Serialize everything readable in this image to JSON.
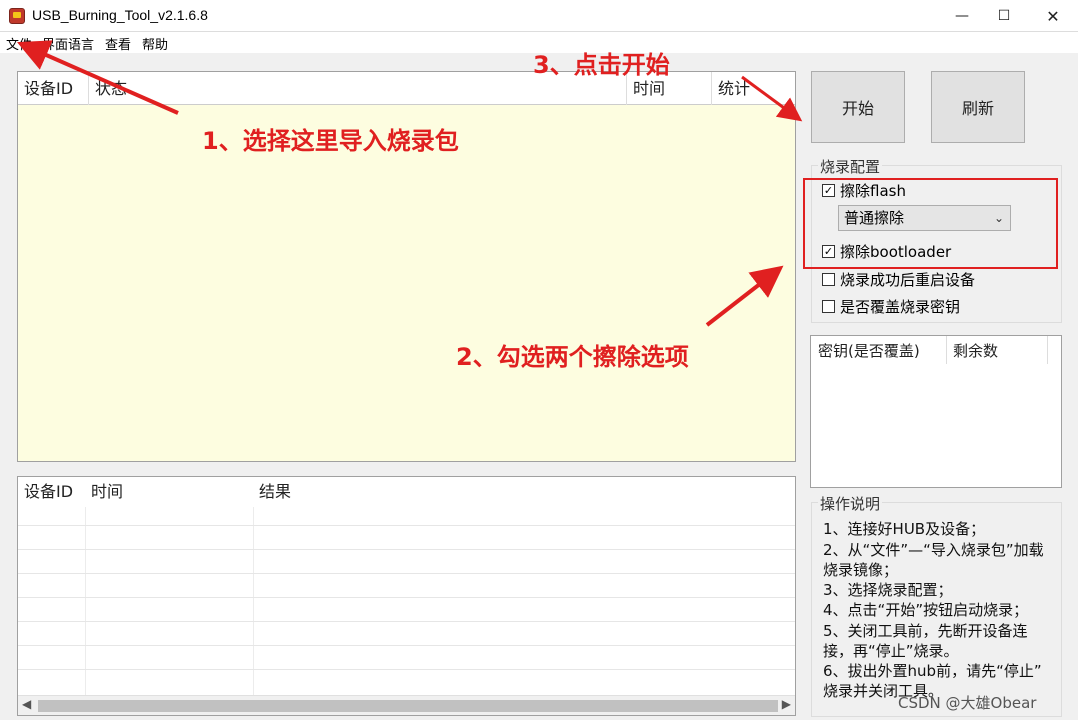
{
  "window": {
    "title": "USB_Burning_Tool_v2.1.6.8"
  },
  "menu": [
    "文件",
    "界面语言",
    "查看",
    "帮助"
  ],
  "status_list": {
    "columns": [
      "设备ID",
      "状态",
      "时间",
      "统计"
    ]
  },
  "result_list": {
    "columns": [
      "设备ID",
      "时间",
      "结果"
    ]
  },
  "buttons": {
    "start": "开始",
    "refresh": "刷新"
  },
  "burn_config": {
    "title": "烧录配置",
    "erase_flash": {
      "label": "擦除flash",
      "checked": true
    },
    "erase_mode": "普通擦除",
    "erase_bootloader": {
      "label": "擦除bootloader",
      "checked": true
    },
    "reboot_after": {
      "label": "烧录成功后重启设备",
      "checked": false
    },
    "overwrite_key": {
      "label": "是否覆盖烧录密钥",
      "checked": false
    }
  },
  "key_list": {
    "columns": [
      "密钥(是否覆盖)",
      "剩余数"
    ]
  },
  "instructions": {
    "title": "操作说明",
    "lines": [
      "1、连接好HUB及设备；",
      "2、从“文件”—“导入烧录包”加载",
      "烧录镜像；",
      "3、选择烧录配置；",
      "4、点击“开始”按钮启动烧录；",
      "5、关闭工具前，先断开设备连",
      "接，再“停止”烧录。",
      "6、拔出外置hub前，请先“停止”",
      "烧录并关闭工具。"
    ]
  },
  "annotations": {
    "step1": "1、选择这里导入烧录包",
    "step2": "2、勾选两个擦除选项",
    "step3": "3、点击开始"
  },
  "watermark": "CSDN @大雄Obear",
  "colors": {
    "annotation": "#e02020",
    "list_background": "#fdfde0"
  }
}
